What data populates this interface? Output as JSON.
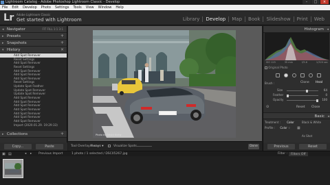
{
  "window": {
    "title": "Lightroom Catalog - Adobe Photoshop Lightroom Classic - Develop"
  },
  "menu": [
    "File",
    "Edit",
    "Develop",
    "Photo",
    "Settings",
    "Tools",
    "View",
    "Window",
    "Help"
  ],
  "identity": {
    "logo": "Lr",
    "brand": "Adobe Lightroom Classic",
    "tagline": "Get started with Lightroom"
  },
  "modules": {
    "library": "Library",
    "develop": "Develop",
    "map": "Map",
    "book": "Book",
    "slideshow": "Slideshow",
    "print": "Print",
    "web": "Web"
  },
  "left_panel": {
    "navigator": "Navigator",
    "navigator_tools": "FIT  FILL  1:1  3:1",
    "presets": "Presets",
    "snapshots": "Snapshots",
    "history": "History",
    "history_items": [
      "Add Spot Remover",
      "Reset Settings",
      "Add Spot Remover",
      "Reset Settings",
      "Add Spot Remover",
      "Add Spot Remover",
      "Add Spot Remover",
      "Reset Settings",
      "Update Spot Feather",
      "Update Spot Remover",
      "Update Spot Remover",
      "Add Spot Remover",
      "Add Spot Remover",
      "Add Spot Remover",
      "Add Spot Remover",
      "Add Spot Remover",
      "Add Spot Remover",
      "Add Spot Remover",
      "Import (2020.01.29. 19:29:33)"
    ],
    "collections": "Collections",
    "copy": "Copy...",
    "paste": "Paste"
  },
  "photo": {
    "watermark": "Photo by Dávid Király"
  },
  "toolbar": {
    "tool_overlay_label": "Tool Overlay :",
    "tool_overlay_value": "Always ▾",
    "visualize_spots": "Visualize Spots",
    "done": "Done"
  },
  "right_panel": {
    "histogram": "Histogram",
    "hist_info": [
      "ISO 125",
      "35 mm",
      "f/5.6",
      "1/320 sec"
    ],
    "original_photo": "Original Photo",
    "brush_label": "Brush :",
    "clone": "Clone",
    "heal": "Heal",
    "size_label": "Size",
    "size_value": "64",
    "feather_label": "Feather",
    "feather_value": "0",
    "opacity_label": "Opacity",
    "opacity_value": "100",
    "reset": "Reset",
    "close": "Close",
    "basic": "Basic",
    "treatment_label": "Treatment :",
    "color": "Color",
    "bw": "Black & White",
    "profile_label": "Profile :",
    "profile_value": "Color ♢",
    "as_shot": "As Shot",
    "previous": "Previous",
    "reset_btn": "Reset"
  },
  "filmstrip": {
    "previous_import": "Previous Import",
    "selection": "1 photo / 1 selected / DSC05267.jpg",
    "filter_label": "Filter :",
    "filter_value": "Filters Off"
  },
  "colors": {
    "accent": "#d8d8d8",
    "panel": "#2e2e2e",
    "background": "#5a5a5a"
  },
  "slider_levels": {
    "size": 0.64,
    "feather": 0.0,
    "opacity": 1.0
  }
}
